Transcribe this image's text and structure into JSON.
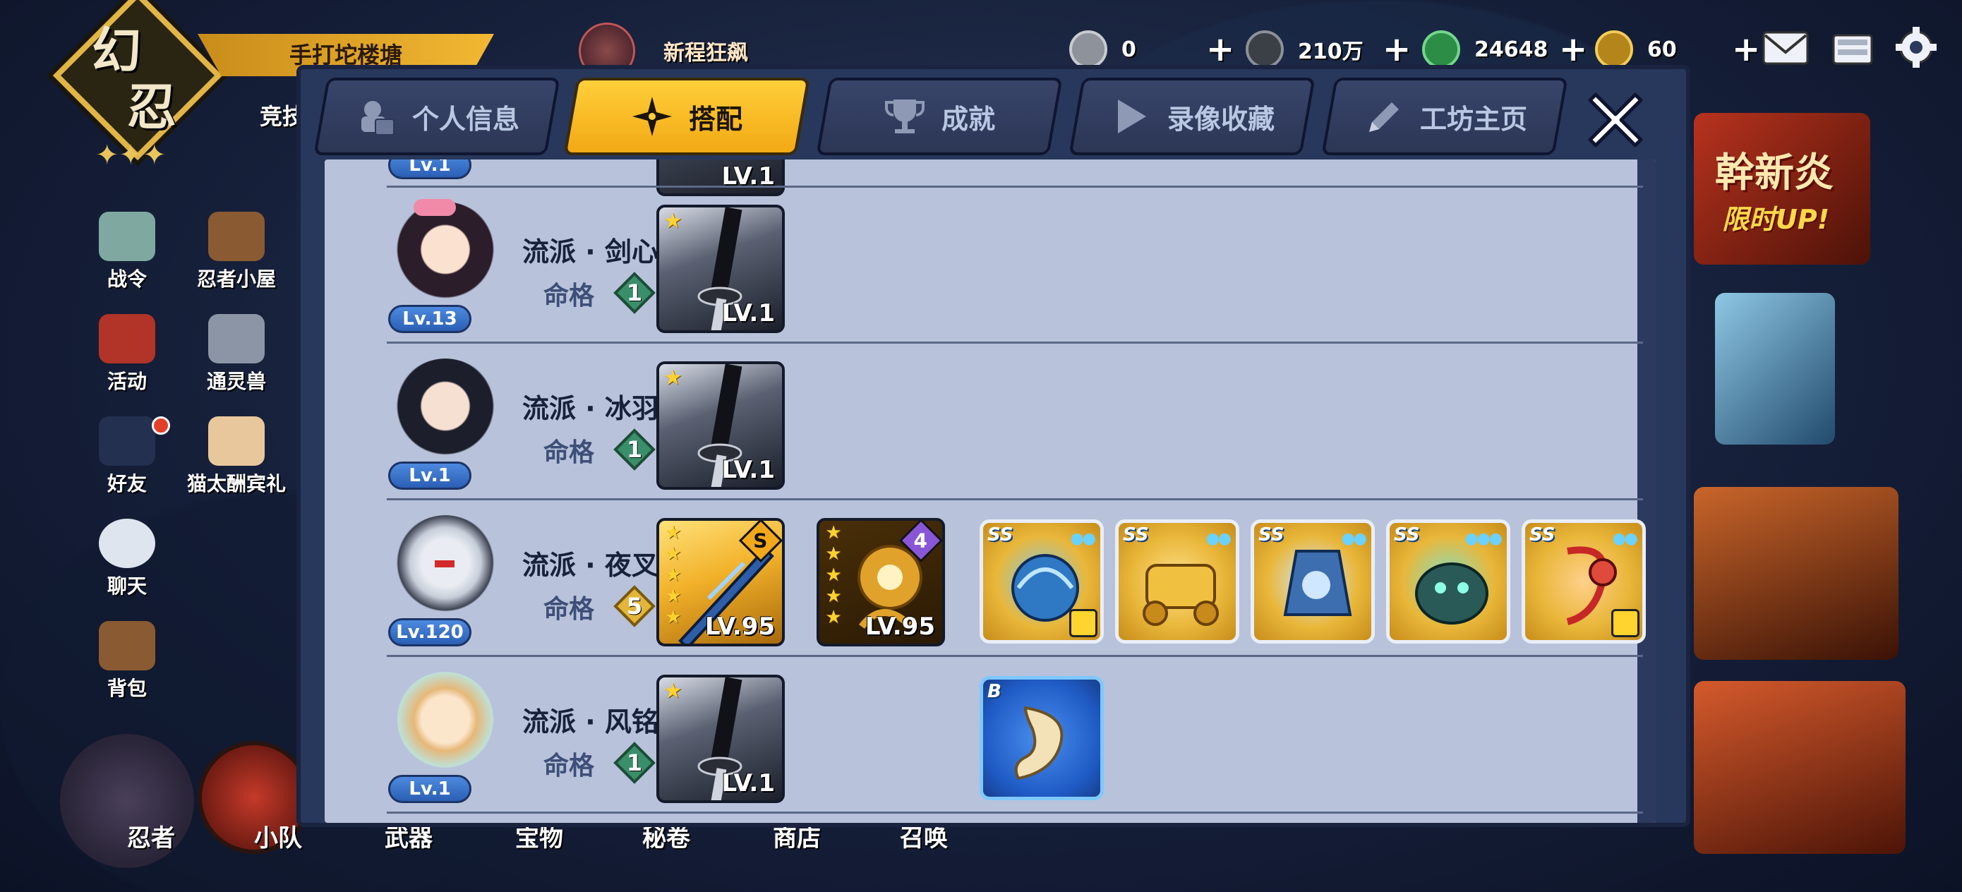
{
  "logo": {
    "text_top": "幻",
    "text_bottom": "忍"
  },
  "header": {
    "banner": "手打坨楼塘",
    "side_label": "竞技",
    "event_title": "新程狂飙"
  },
  "resources": [
    {
      "name": "coin-silver",
      "value": "0",
      "color": "#9aa0a8"
    },
    {
      "name": "coin-dark",
      "value": "210万",
      "color": "#555a63"
    },
    {
      "name": "jade",
      "value": "24648",
      "color": "#3fb15a"
    },
    {
      "name": "gold",
      "value": "60",
      "color": "#d8a728"
    }
  ],
  "left_menu": [
    {
      "id": "battle-pass",
      "label": "战令"
    },
    {
      "id": "ninja-house",
      "label": "忍者小屋"
    },
    {
      "id": "event",
      "label": "活动"
    },
    {
      "id": "summon-beast",
      "label": "通灵兽"
    },
    {
      "id": "friends",
      "label": "好友"
    },
    {
      "id": "cat-gift",
      "label": "猫太酬宾礼"
    },
    {
      "id": "chat",
      "label": "聊天"
    },
    {
      "id": "bag",
      "label": "背包"
    }
  ],
  "bottom_nav": [
    "忍者",
    "小队",
    "武器",
    "宝物",
    "秘卷",
    "商店",
    "召唤"
  ],
  "ads": {
    "ad1_line1": "幹新炎",
    "ad1_line2": "限时UP!"
  },
  "tabs": [
    {
      "id": "profile",
      "label": "个人信息",
      "active": false
    },
    {
      "id": "loadout",
      "label": "搭配",
      "active": true
    },
    {
      "id": "achievement",
      "label": "成就",
      "active": false
    },
    {
      "id": "replay",
      "label": "录像收藏",
      "active": false
    },
    {
      "id": "workshop",
      "label": "工坊主页",
      "active": false
    }
  ],
  "fate_label": "命格",
  "partial_row": {
    "level": "Lv.1",
    "weapon_level": "LV.1"
  },
  "rows": [
    {
      "level": "Lv.13",
      "school": "流派 · 剑心",
      "fate": "1",
      "weapon": {
        "level": "LV.1",
        "stars": "★"
      }
    },
    {
      "level": "Lv.1",
      "school": "流派 · 冰羽",
      "fate": "1",
      "weapon": {
        "level": "LV.1",
        "stars": "★"
      }
    },
    {
      "level": "Lv.120",
      "school": "流派 · 夜叉",
      "fate": "5",
      "weapon": {
        "level": "LV.95",
        "stars": "★★★★★",
        "rank": "S"
      },
      "treasure": {
        "level": "LV.95",
        "stars": "★★★★★",
        "rank": "4"
      },
      "skills": [
        {
          "grade": "SS",
          "dots": "●●",
          "marked": true
        },
        {
          "grade": "SS",
          "dots": "●●",
          "marked": false
        },
        {
          "grade": "SS",
          "dots": "●●",
          "marked": false
        },
        {
          "grade": "SS",
          "dots": "●●●",
          "marked": false
        },
        {
          "grade": "SS",
          "dots": "●●",
          "marked": true
        }
      ]
    },
    {
      "level": "Lv.1",
      "school": "流派 · 风铭",
      "fate": "1",
      "weapon": {
        "level": "LV.1",
        "stars": "★"
      },
      "scroll": {
        "grade": "B"
      }
    }
  ]
}
